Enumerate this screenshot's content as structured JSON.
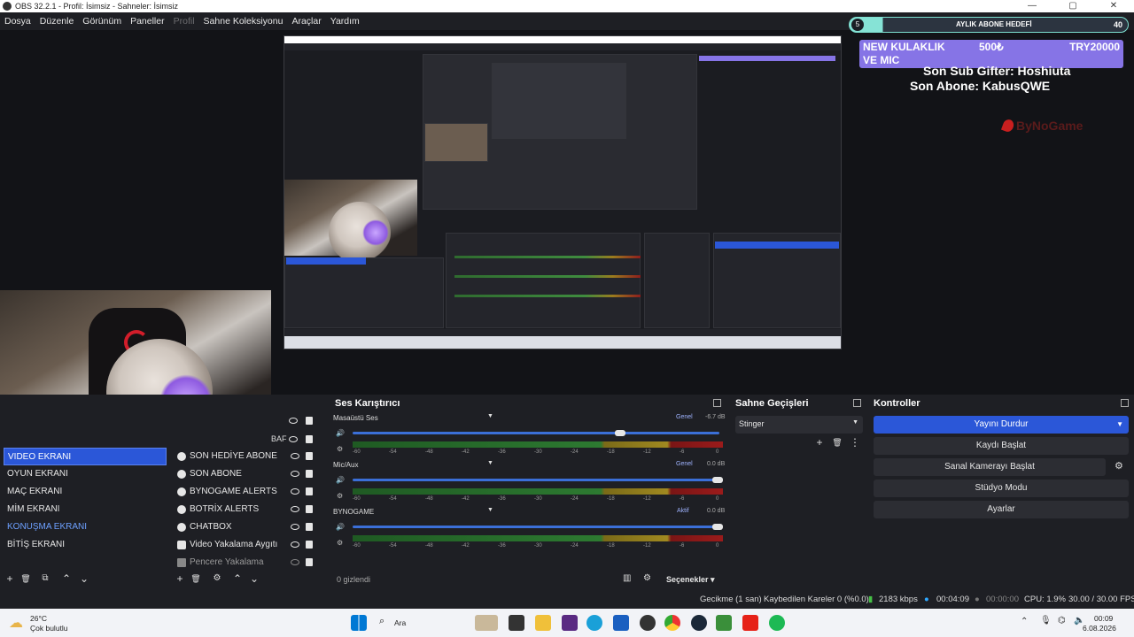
{
  "window": {
    "title": "OBS 32.2.1 - Profil: İsimsiz - Sahneler: İsimsiz",
    "controls": [
      "—",
      "▢",
      "✕"
    ]
  },
  "menu": [
    {
      "label": "Dosya",
      "disabled": false
    },
    {
      "label": "Düzenle",
      "disabled": false
    },
    {
      "label": "Görünüm",
      "disabled": false
    },
    {
      "label": "Paneller",
      "disabled": false
    },
    {
      "label": "Profil",
      "disabled": true
    },
    {
      "label": "Sahne Koleksiyonu",
      "disabled": false
    },
    {
      "label": "Araçlar",
      "disabled": false
    },
    {
      "label": "Yardım",
      "disabled": false
    }
  ],
  "overlay": {
    "goal_badge": "5",
    "goal_title": "AYLIK ABONE HEDEFİ",
    "goal_count": "40",
    "goal_progress": 0.12,
    "ticker_a": "NEW KULAKLIK",
    "ticker_b": "500₺",
    "ticker_c": "TRY20000",
    "ticker_d": "VE MIC",
    "sub_gifter": "Son Sub Gifter: Hoshiuta",
    "last_sub": "Son Abone: KabusQWE",
    "brand": "ByNoGame"
  },
  "scenes_dock": {
    "items": [
      {
        "label": "VIDEO EKRANI",
        "selected": true
      },
      {
        "label": "OYUN EKRANI",
        "selected": false
      },
      {
        "label": "MAÇ EKRANI",
        "selected": false
      },
      {
        "label": "MİM EKRANI",
        "selected": false
      },
      {
        "label": "KONUŞMA EKRANI",
        "selected": false
      },
      {
        "label": "BİTİŞ EKRANI",
        "selected": false
      }
    ],
    "toolbar": [
      "+",
      "🗑",
      "⧉",
      "⌃",
      "⌄"
    ]
  },
  "sources_dock": {
    "partial_label": "BAF",
    "items": [
      {
        "label": "SON HEDİYE ABONE"
      },
      {
        "label": "SON ABONE"
      },
      {
        "label": "BYNOGAME ALERTS"
      },
      {
        "label": "BOTRİX ALERTS"
      },
      {
        "label": "CHATBOX"
      },
      {
        "label": "Video Yakalama Aygıtı"
      },
      {
        "label": "Pencere Yakalama"
      }
    ],
    "toolbar": [
      "+",
      "🗑",
      "⚙",
      "⌃",
      "⌄"
    ]
  },
  "mixer": {
    "title": "Ses Karıştırıcı",
    "channels": [
      {
        "name": "Masaüstü Ses",
        "tag": "Genel",
        "db": "-6.7 dB",
        "volume": 0.73
      },
      {
        "name": "Mic/Aux",
        "tag": "Genel",
        "db": "0.0 dB",
        "volume": 1.0
      },
      {
        "name": "BYNOGAME",
        "tag": "Aktif",
        "db": "0.0 dB",
        "volume": 1.0
      }
    ],
    "scale": [
      "-60",
      "-54",
      "-48",
      "-42",
      "-36",
      "-30",
      "-24",
      "-18",
      "-12",
      "-6",
      "0"
    ],
    "hidden_count": "0 gizlendi",
    "options_label": "Seçenekler"
  },
  "transitions": {
    "title": "Sahne Geçişleri",
    "selected": "Stinger"
  },
  "controls": {
    "title": "Kontroller",
    "buttons": [
      {
        "label": "Yayını Durdur",
        "primary": true
      },
      {
        "label": "Kaydı Başlat",
        "primary": false
      },
      {
        "label": "Sanal Kamerayı Başlat",
        "primary": false
      },
      {
        "label": "Stüdyo Modu",
        "primary": false
      },
      {
        "label": "Ayarlar",
        "primary": false
      }
    ]
  },
  "status": {
    "delay": "Gecikme (1 san)",
    "dropped": "Kaybedilen Kareler 0 (%0.0)",
    "bitrate": "2183 kbps",
    "stream_time": "00:04:09",
    "rec_time": "00:00:00",
    "cpu": "CPU: 1.9%",
    "fps": "30.00 / 30.00 FPS"
  },
  "taskbar": {
    "weather_temp": "26°C",
    "weather_desc": "Çok bulutlu",
    "search": "Ara",
    "time": "00:09",
    "date": "6.08.2026"
  }
}
